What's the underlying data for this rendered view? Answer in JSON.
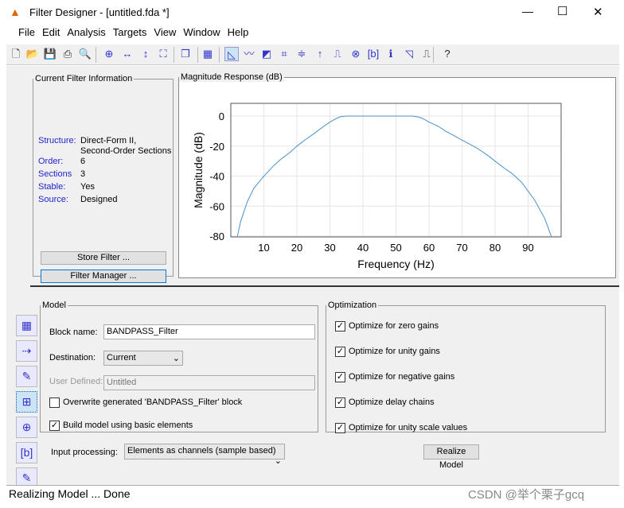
{
  "window": {
    "title": "Filter Designer -  [untitled.fda *]",
    "minimize": "—",
    "maximize": "☐",
    "close": "✕"
  },
  "menu": [
    "File",
    "Edit",
    "Analysis",
    "Targets",
    "View",
    "Window",
    "Help"
  ],
  "toolbar": [
    "new-icon",
    "open-icon",
    "save-icon",
    "print-icon",
    "print-preview-icon",
    "zoom-in-icon",
    "zoom-x-icon",
    "zoom-y-icon",
    "full-view-icon",
    "new-window-icon",
    "filter-spec-icon",
    "magnitude-response-icon",
    "phase-response-icon",
    "mag-phase-icon",
    "group-delay-icon",
    "phase-delay-icon",
    "impulse-response-icon",
    "step-response-icon",
    "pole-zero-icon",
    "coefficients-icon",
    "info-icon",
    "magnitude-estimate-icon",
    "noise-power-icon",
    "whats-this-icon"
  ],
  "info": {
    "title": "Current Filter Information",
    "rows": [
      {
        "label": "Structure:",
        "value": "Direct-Form II,\nSecond-Order Sections"
      },
      {
        "label": "Order:",
        "value": "6"
      },
      {
        "label": "Sections",
        "value": "3"
      },
      {
        "label": "Stable:",
        "value": "Yes"
      },
      {
        "label": "Source:",
        "value": "Designed"
      }
    ],
    "store": "Store Filter ...",
    "manager": "Filter Manager ..."
  },
  "plot": {
    "title": "Magnitude Response (dB)"
  },
  "chart_data": {
    "type": "line",
    "xlabel": "Frequency (Hz)",
    "ylabel": "Magnitude (dB)",
    "xlim": [
      0,
      100
    ],
    "ylim": [
      -80.5,
      8.5
    ],
    "grid": true,
    "xticks": [
      10,
      20,
      30,
      40,
      50,
      60,
      70,
      80,
      90
    ],
    "yticks": [
      0,
      -20,
      -40,
      -60,
      -80
    ],
    "color": "#4a90c8",
    "x": [
      2,
      3,
      5,
      7,
      10,
      13,
      15,
      18,
      20,
      23,
      25,
      28,
      30,
      32,
      33,
      35,
      40,
      50,
      55,
      57,
      58,
      60,
      63,
      65,
      68,
      70,
      73,
      75,
      78,
      80,
      83,
      85,
      88,
      90,
      92,
      93,
      95,
      96,
      97
    ],
    "y": [
      -80,
      -70,
      -57,
      -48,
      -40,
      -33,
      -29,
      -24,
      -20,
      -15,
      -12,
      -7,
      -4,
      -1.5,
      -0.5,
      0,
      0,
      0,
      0,
      -0.7,
      -1.5,
      -4,
      -7,
      -10,
      -13.5,
      -16,
      -19.5,
      -22,
      -26.5,
      -30,
      -35,
      -38,
      -44,
      -50,
      -56,
      -60,
      -68,
      -74,
      -80
    ]
  },
  "model": {
    "title": "Model",
    "block_label": "Block name:",
    "block_value": "BANDPASS_Filter",
    "dest_label": "Destination:",
    "dest_value": "Current",
    "user_label": "User Defined:",
    "user_value": "Untitled",
    "overwrite": "Overwrite generated 'BANDPASS_Filter' block",
    "overwrite_checked": false,
    "basic": "Build model using basic elements",
    "basic_checked": true
  },
  "opt": {
    "title": "Optimization",
    "items": [
      "Optimize for zero gains",
      "Optimize for unity gains",
      "Optimize for negative gains",
      "Optimize delay chains",
      "Optimize for unity scale values"
    ]
  },
  "input_label": "Input processing:",
  "input_value": "Elements as channels (sample based)",
  "realize": "Realize Model",
  "sidebar": [
    "design-filter-icon",
    "transform-filter-icon",
    "import-filter-icon",
    "realize-model-icon",
    "pole-zero-editor-icon",
    "multirate-icon",
    "quantize-icon"
  ],
  "status": "Realizing Model ... Done",
  "watermark": "CSDN @举个栗子gcq"
}
